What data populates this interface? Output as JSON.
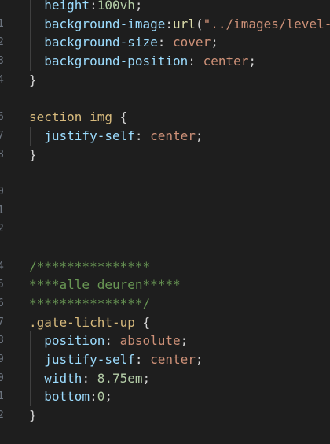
{
  "editor": {
    "lines": [
      {
        "n": "",
        "indent": 1,
        "tokens": [
          [
            "prop",
            "height"
          ],
          [
            "punct",
            ":"
          ],
          [
            "num",
            "100vh"
          ],
          [
            "punct",
            ";"
          ]
        ]
      },
      {
        "n": "1",
        "indent": 1,
        "tokens": [
          [
            "prop",
            "background-image"
          ],
          [
            "punct",
            ":"
          ],
          [
            "fn",
            "url"
          ],
          [
            "punct",
            "("
          ],
          [
            "str",
            "\"../images/level-"
          ]
        ]
      },
      {
        "n": "2",
        "indent": 1,
        "tokens": [
          [
            "prop",
            "background-size"
          ],
          [
            "punct",
            ": "
          ],
          [
            "val",
            "cover"
          ],
          [
            "punct",
            ";"
          ]
        ]
      },
      {
        "n": "3",
        "indent": 1,
        "tokens": [
          [
            "prop",
            "background-position"
          ],
          [
            "punct",
            ": "
          ],
          [
            "val",
            "center"
          ],
          [
            "punct",
            ";"
          ]
        ]
      },
      {
        "n": "4",
        "indent": 0,
        "tokens": [
          [
            "punct",
            "}"
          ]
        ]
      },
      {
        "n": "",
        "indent": 0,
        "tokens": []
      },
      {
        "n": "6",
        "indent": 0,
        "tokens": [
          [
            "sel",
            "section img "
          ],
          [
            "punct",
            "{"
          ]
        ]
      },
      {
        "n": "7",
        "indent": 1,
        "tokens": [
          [
            "prop",
            "justify-self"
          ],
          [
            "punct",
            ": "
          ],
          [
            "val",
            "center"
          ],
          [
            "punct",
            ";"
          ]
        ]
      },
      {
        "n": "8",
        "indent": 0,
        "tokens": [
          [
            "punct",
            "}"
          ]
        ]
      },
      {
        "n": "",
        "indent": 0,
        "tokens": []
      },
      {
        "n": "0",
        "indent": 0,
        "tokens": []
      },
      {
        "n": "1",
        "indent": 0,
        "tokens": []
      },
      {
        "n": "2",
        "indent": 0,
        "tokens": []
      },
      {
        "n": "",
        "indent": 0,
        "tokens": []
      },
      {
        "n": "4",
        "indent": 0,
        "tokens": [
          [
            "comment",
            "/***************"
          ]
        ]
      },
      {
        "n": "5",
        "indent": 0,
        "tokens": [
          [
            "comment",
            "****alle deuren*****"
          ]
        ]
      },
      {
        "n": "6",
        "indent": 0,
        "tokens": [
          [
            "comment",
            "***************/"
          ]
        ]
      },
      {
        "n": "7",
        "indent": 0,
        "tokens": [
          [
            "sel",
            ".gate-licht-up "
          ],
          [
            "punct",
            "{"
          ]
        ]
      },
      {
        "n": "8",
        "indent": 1,
        "tokens": [
          [
            "prop",
            "position"
          ],
          [
            "punct",
            ": "
          ],
          [
            "val",
            "absolute"
          ],
          [
            "punct",
            ";"
          ]
        ]
      },
      {
        "n": "9",
        "indent": 1,
        "tokens": [
          [
            "prop",
            "justify-self"
          ],
          [
            "punct",
            ": "
          ],
          [
            "val",
            "center"
          ],
          [
            "punct",
            ";"
          ]
        ]
      },
      {
        "n": "0",
        "indent": 1,
        "tokens": [
          [
            "prop",
            "width"
          ],
          [
            "punct",
            ": "
          ],
          [
            "num",
            "8.75em"
          ],
          [
            "punct",
            ";"
          ]
        ]
      },
      {
        "n": "1",
        "indent": 1,
        "tokens": [
          [
            "prop",
            "bottom"
          ],
          [
            "punct",
            ":"
          ],
          [
            "num",
            "0"
          ],
          [
            "punct",
            ";"
          ]
        ]
      },
      {
        "n": "2",
        "indent": 0,
        "tokens": [
          [
            "punct",
            "}"
          ]
        ]
      },
      {
        "n": "",
        "indent": 0,
        "tokens": []
      }
    ]
  }
}
